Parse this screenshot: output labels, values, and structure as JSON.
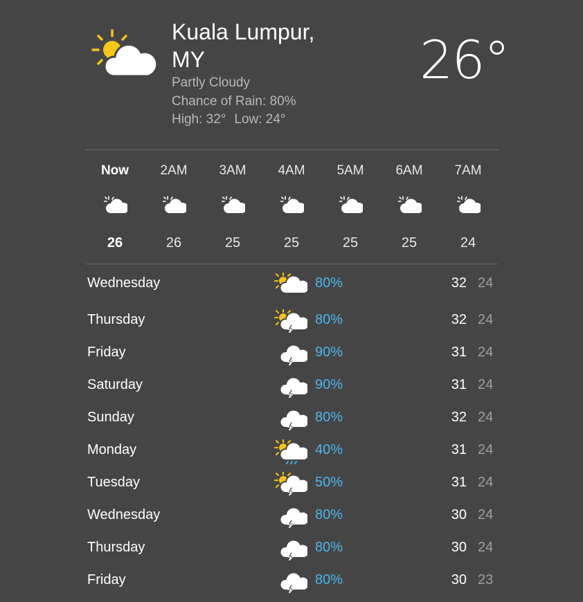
{
  "location": {
    "city": "Kuala Lumpur,",
    "country": "MY"
  },
  "current": {
    "condition": "Partly Cloudy",
    "rain_text": "Chance of Rain: 80%",
    "high_text": "High: 32°",
    "low_text": "Low: 24°",
    "temperature": "26°",
    "icon": "partly-cloudy-day-icon"
  },
  "colors": {
    "background": "#454545",
    "rain_accent": "#4ab7ef",
    "sun": "#f5c518",
    "cloud": "#ffffff",
    "low_temp": "#a0a0a0"
  },
  "hourly": [
    {
      "label": "Now",
      "temp": "26",
      "icon": "partly-cloudy-night-icon"
    },
    {
      "label": "2AM",
      "temp": "26",
      "icon": "partly-cloudy-night-icon"
    },
    {
      "label": "3AM",
      "temp": "25",
      "icon": "partly-cloudy-night-icon"
    },
    {
      "label": "4AM",
      "temp": "25",
      "icon": "partly-cloudy-night-icon"
    },
    {
      "label": "5AM",
      "temp": "25",
      "icon": "partly-cloudy-night-icon"
    },
    {
      "label": "6AM",
      "temp": "25",
      "icon": "partly-cloudy-night-icon"
    },
    {
      "label": "7AM",
      "temp": "24",
      "icon": "partly-cloudy-night-icon"
    }
  ],
  "daily": [
    {
      "day": "Wednesday",
      "icon": "partly-cloudy-day-icon",
      "rain": "80%",
      "high": "32",
      "low": "24"
    },
    {
      "day": "Thursday",
      "icon": "sun-thunderstorm-icon",
      "rain": "80%",
      "high": "32",
      "low": "24"
    },
    {
      "day": "Friday",
      "icon": "thunderstorm-icon",
      "rain": "90%",
      "high": "31",
      "low": "24"
    },
    {
      "day": "Saturday",
      "icon": "thunderstorm-icon",
      "rain": "90%",
      "high": "31",
      "low": "24"
    },
    {
      "day": "Sunday",
      "icon": "thunderstorm-icon",
      "rain": "80%",
      "high": "32",
      "low": "24"
    },
    {
      "day": "Monday",
      "icon": "sun-rain-icon",
      "rain": "40%",
      "high": "31",
      "low": "24"
    },
    {
      "day": "Tuesday",
      "icon": "sun-thunderstorm-icon",
      "rain": "50%",
      "high": "31",
      "low": "24"
    },
    {
      "day": "Wednesday",
      "icon": "thunderstorm-icon",
      "rain": "80%",
      "high": "30",
      "low": "24"
    },
    {
      "day": "Thursday",
      "icon": "thunderstorm-icon",
      "rain": "80%",
      "high": "30",
      "low": "24"
    },
    {
      "day": "Friday",
      "icon": "thunderstorm-icon",
      "rain": "80%",
      "high": "30",
      "low": "23"
    }
  ]
}
